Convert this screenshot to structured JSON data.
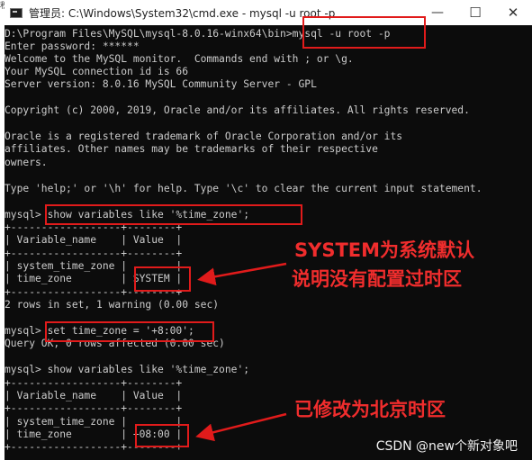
{
  "edge_char": "积",
  "window": {
    "title": "管理员: C:\\Windows\\System32\\cmd.exe - mysql  -u root -p",
    "controls": {
      "minimize": "—",
      "maximize": "☐",
      "close": "✕"
    }
  },
  "console": {
    "lines": [
      "D:\\Program Files\\MySQL\\mysql-8.0.16-winx64\\bin>mysql -u root -p",
      "Enter password: ******",
      "Welcome to the MySQL monitor.  Commands end with ; or \\g.",
      "Your MySQL connection id is 66",
      "Server version: 8.0.16 MySQL Community Server - GPL",
      "",
      "Copyright (c) 2000, 2019, Oracle and/or its affiliates. All rights reserved.",
      "",
      "Oracle is a registered trademark of Oracle Corporation and/or its",
      "affiliates. Other names may be trademarks of their respective",
      "owners.",
      "",
      "Type 'help;' or '\\h' for help. Type '\\c' to clear the current input statement.",
      "",
      "mysql> show variables like '%time_zone';",
      "+------------------+--------+",
      "| Variable_name    | Value  |",
      "+------------------+--------+",
      "| system_time_zone |        |",
      "| time_zone        | SYSTEM |",
      "+------------------+--------+",
      "2 rows in set, 1 warning (0.00 sec)",
      "",
      "mysql> set time_zone = '+8:00';",
      "Query OK, 0 rows affected (0.00 sec)",
      "",
      "mysql> show variables like '%time_zone';",
      "+------------------+--------+",
      "| Variable_name    | Value  |",
      "+------------------+--------+",
      "| system_time_zone |        |",
      "| time_zone        | +08:00 |",
      "+------------------+--------+"
    ]
  },
  "annotations": {
    "note1_line1": "SYSTEM为系统默认",
    "note1_line2": "说明没有配置过时区",
    "note2": "已修改为北京时区"
  },
  "watermark": "CSDN @new个新对象吧",
  "colors": {
    "annotation_red": "#e11b1b",
    "console_bg": "#0c0c0c",
    "console_text": "#cccccc"
  }
}
